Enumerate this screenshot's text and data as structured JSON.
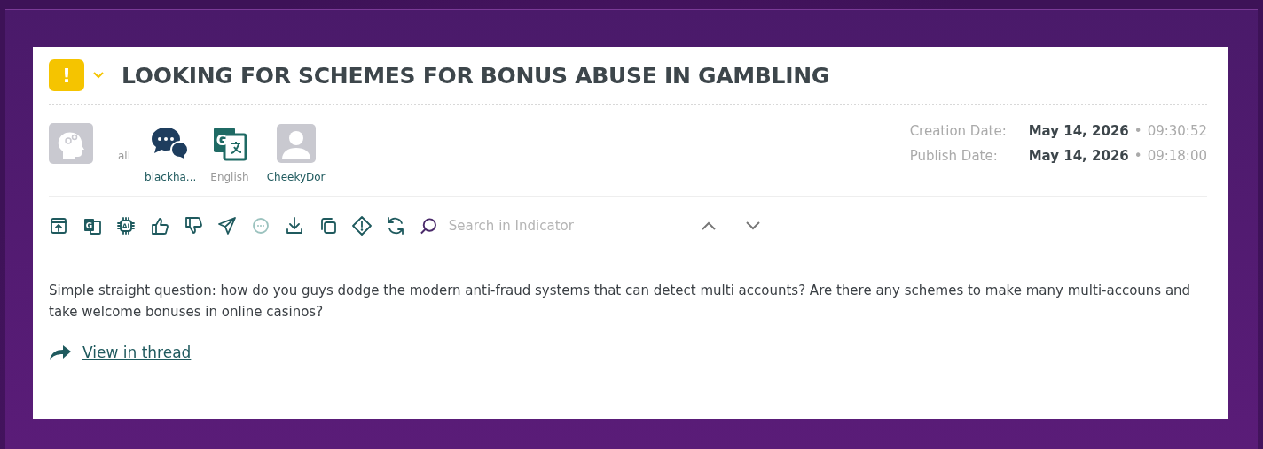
{
  "header": {
    "severity_glyph": "!",
    "title": "LOOKING FOR SCHEMES FOR BONUS ABUSE IN GAMBLING"
  },
  "meta": [
    {
      "kind": "head",
      "label": "all"
    },
    {
      "kind": "chat",
      "label": "blackha..."
    },
    {
      "kind": "translate",
      "label": "English",
      "glyph": "G"
    },
    {
      "kind": "user",
      "label": "CheekyDor"
    }
  ],
  "dates": [
    {
      "label": "Creation Date:",
      "date": "May 14, 2026",
      "separator": "•",
      "time": "09:30:52"
    },
    {
      "label": "Publish Date:",
      "date": "May 14, 2026",
      "separator": "•",
      "time": "09:18:00"
    }
  ],
  "toolbar": [
    {
      "kind": "open",
      "disabled": false
    },
    {
      "kind": "translate",
      "disabled": false,
      "glyph": "G"
    },
    {
      "kind": "ai",
      "disabled": false,
      "glyph": "AI"
    },
    {
      "kind": "like",
      "disabled": false
    },
    {
      "kind": "dislike",
      "disabled": false
    },
    {
      "kind": "send",
      "disabled": false
    },
    {
      "kind": "comment",
      "disabled": true
    },
    {
      "kind": "download",
      "disabled": false
    },
    {
      "kind": "copy",
      "disabled": false
    },
    {
      "kind": "alert",
      "disabled": false
    },
    {
      "kind": "refresh",
      "disabled": false
    }
  ],
  "search": {
    "placeholder": "Search in Indicator"
  },
  "body": "Simple straight question: how do you guys dodge the modern anti-fraud systems that can detect multi accounts? Are there any schemes to make many multi-accouns and take welcome bonuses in online casinos?",
  "link": "View in thread"
}
